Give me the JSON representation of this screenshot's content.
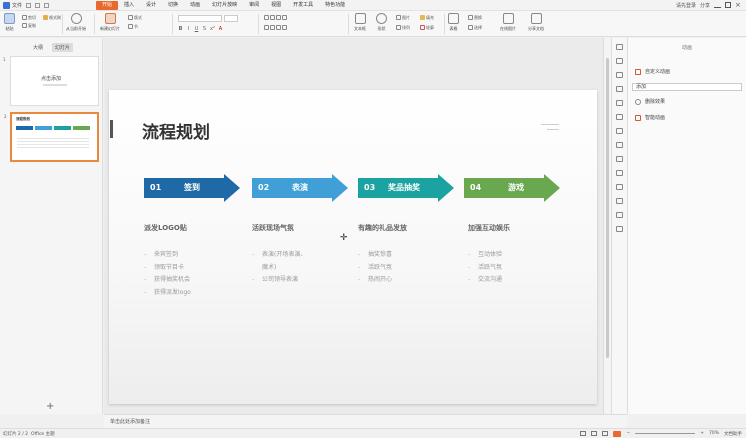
{
  "menubar": {
    "app_label": "文件",
    "tabs": [
      "开始",
      "插入",
      "设计",
      "切换",
      "动画",
      "幻灯片放映",
      "审阅",
      "视图",
      "开发工具",
      "特色功能"
    ],
    "active_tab": "开始",
    "right": [
      "请先登录",
      "分享",
      "帮助",
      "登录"
    ]
  },
  "ribbon": {
    "groups": [
      "粘贴",
      "剪切",
      "复制",
      "格式刷",
      "从当前开始",
      "新建幻灯片",
      "版式",
      "节",
      "文本框",
      "形状",
      "排列",
      "图片",
      "文字",
      "表格",
      "填充",
      "轮廓",
      "替换",
      "选择",
      "在线图片",
      "分享文档"
    ]
  },
  "left_pane": {
    "tabs": [
      "大纲",
      "幻灯片"
    ],
    "active_tab": "幻灯片",
    "slide_numbers": [
      "1",
      "2"
    ],
    "thumb1_title": "点击添加",
    "thumb2_title": "流程规划",
    "add_slide": "+"
  },
  "slide": {
    "title": "流程规划",
    "steps": [
      {
        "num": "01",
        "name": "签到",
        "color": "#1f6aa6"
      },
      {
        "num": "02",
        "name": "表演",
        "color": "#3f9fd6"
      },
      {
        "num": "03",
        "name": "奖品抽奖",
        "color": "#1aa3a0"
      },
      {
        "num": "04",
        "name": "游戏",
        "color": "#6aa84f"
      }
    ],
    "columns": [
      {
        "heading": "派发LOGO贴",
        "items": [
          "来宾签到",
          "领取节目卡",
          "获得抽奖机会",
          "获得派发logo"
        ]
      },
      {
        "heading": "活跃现场气氛",
        "items": [
          "表演(开场表演、",
          "魔术)",
          "公司领导表演"
        ]
      },
      {
        "heading": "有趣的礼品发放",
        "items": [
          "抽奖惊喜",
          "活跃气氛",
          "热闹开心"
        ]
      },
      {
        "heading": "加强互动娱乐",
        "items": [
          "互动体验",
          "活跃气氛",
          "交流沟通"
        ]
      }
    ]
  },
  "right_pane": {
    "title": "动画",
    "items": [
      "自定义动画",
      "删除效果",
      "智能动画"
    ],
    "select": "添加"
  },
  "notes": "单击此处添加备注",
  "status": {
    "left": "幻灯片 2 / 2",
    "theme": "Office 主题",
    "zoom": "70%",
    "right_note": "文档助手"
  }
}
